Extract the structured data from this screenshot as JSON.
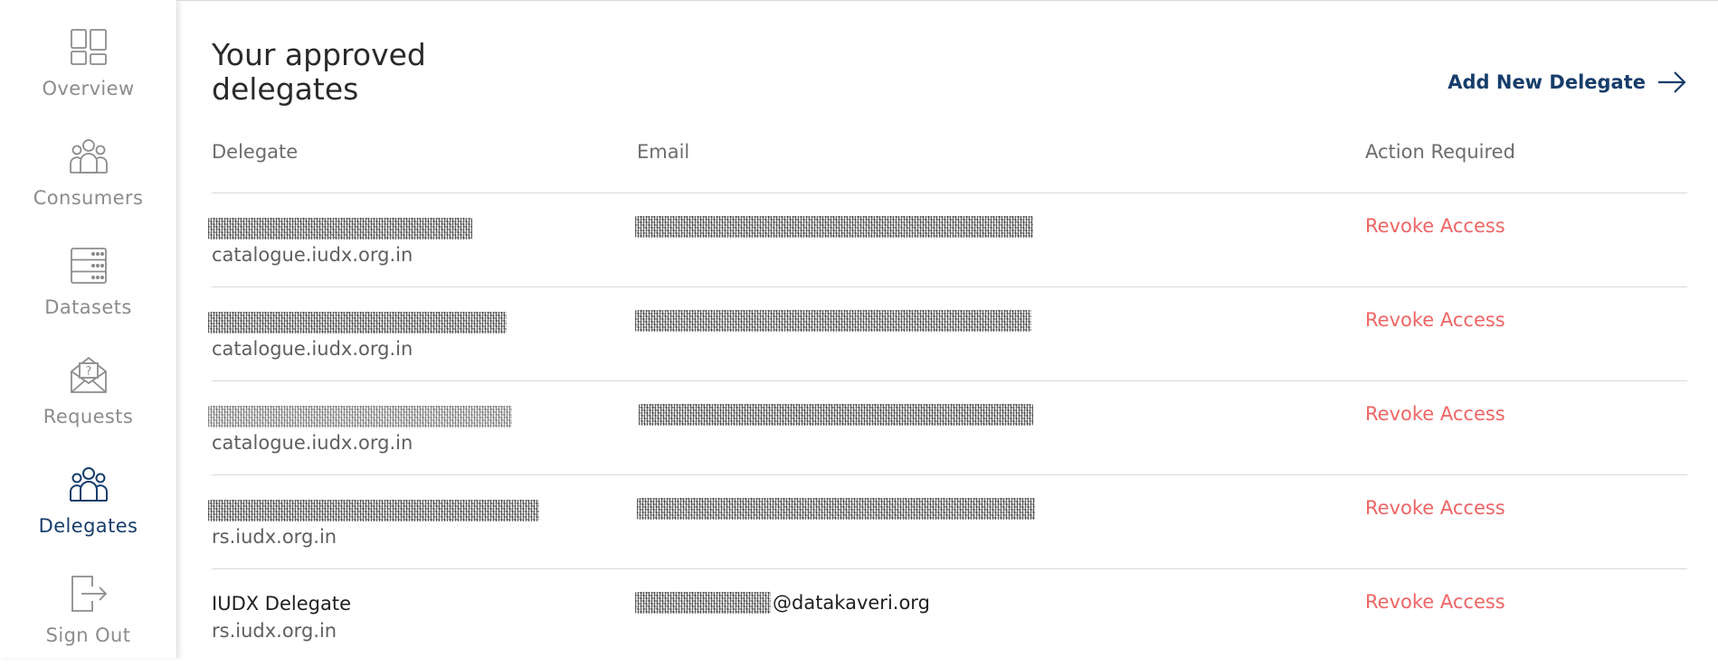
{
  "sidebar": {
    "items": [
      {
        "label": "Overview",
        "icon": "overview-icon",
        "active": false
      },
      {
        "label": "Consumers",
        "icon": "consumers-icon",
        "active": false
      },
      {
        "label": "Datasets",
        "icon": "datasets-icon",
        "active": false
      },
      {
        "label": "Requests",
        "icon": "requests-icon",
        "active": false
      },
      {
        "label": "Delegates",
        "icon": "delegates-icon",
        "active": true
      },
      {
        "label": "Sign Out",
        "icon": "sign-out-icon",
        "active": false
      }
    ]
  },
  "header": {
    "title": "Your approved delegates",
    "add_label": "Add New Delegate"
  },
  "table": {
    "columns": [
      "Delegate",
      "Email",
      "Action Required"
    ],
    "rows": [
      {
        "name": "",
        "server": "catalogue.iudx.org.in",
        "email_visible": "",
        "action": "Revoke Access"
      },
      {
        "name": "",
        "server": "catalogue.iudx.org.in",
        "email_visible": "",
        "action": "Revoke Access"
      },
      {
        "name": "",
        "server": "catalogue.iudx.org.in",
        "email_visible": "",
        "action": "Revoke Access"
      },
      {
        "name": "",
        "server": "rs.iudx.org.in",
        "email_visible": "",
        "action": "Revoke Access"
      },
      {
        "name": "IUDX Delegate",
        "server": "rs.iudx.org.in",
        "email_visible": "@datakaveri.org",
        "action": "Revoke Access"
      }
    ]
  },
  "colors": {
    "accent": "#163d6b",
    "revoke": "#f06464",
    "muted": "#8c8c8c"
  }
}
